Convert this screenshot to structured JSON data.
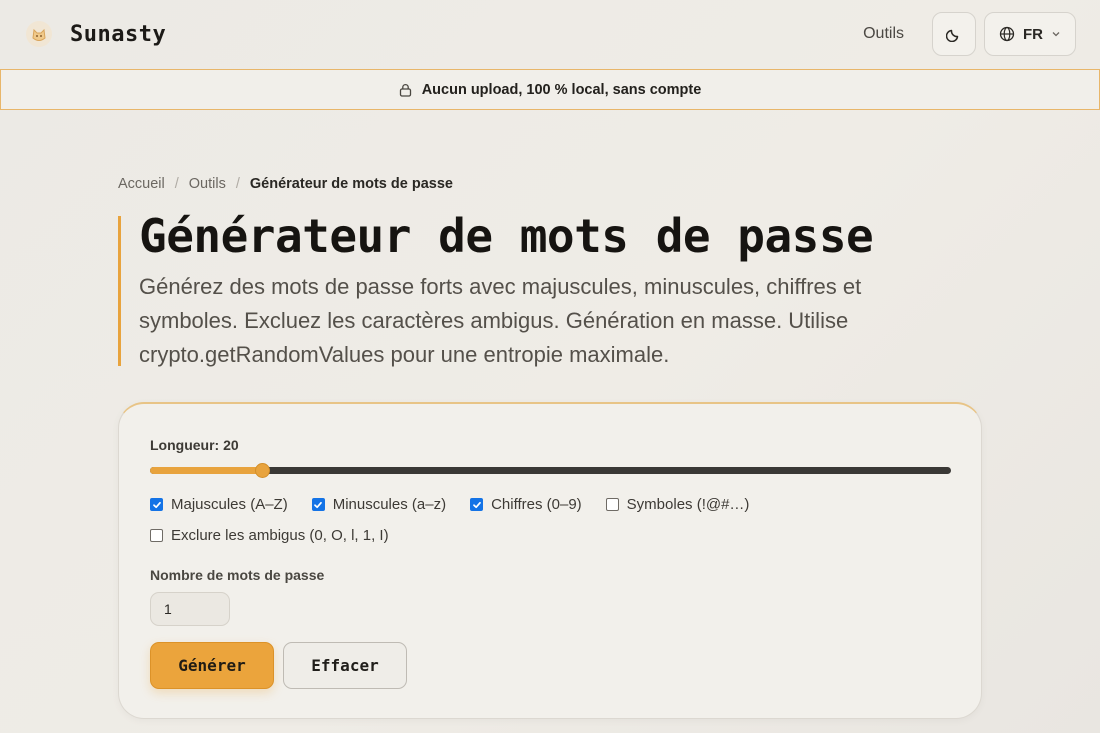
{
  "brand": {
    "name": "Sunasty",
    "logo": "cat-logo-icon"
  },
  "nav": {
    "tools_label": "Outils",
    "theme_icon": "moon-icon",
    "language": "FR",
    "language_icon": "globe-icon"
  },
  "banner": {
    "icon": "lock-icon",
    "text": "Aucun upload, 100 % local, sans compte"
  },
  "breadcrumb": {
    "home": "Accueil",
    "tools": "Outils",
    "current": "Générateur de mots de passe",
    "separator": "/"
  },
  "page": {
    "title": "Générateur de mots de passe",
    "description": "Générez des mots de passe forts avec majuscules, minuscules, chiffres et symboles. Excluez les caractères ambigus. Génération en masse. Utilise crypto.getRandomValues pour une entropie maximale."
  },
  "generator": {
    "length_label": "Longueur: 20",
    "slider_fraction": 0.14,
    "options": [
      {
        "label": "Majuscules (A–Z)",
        "checked": true
      },
      {
        "label": "Minuscules (a–z)",
        "checked": true
      },
      {
        "label": "Chiffres (0–9)",
        "checked": true
      },
      {
        "label": "Symboles (!@#…)",
        "checked": false
      }
    ],
    "exclude_ambiguous": {
      "label": "Exclure les ambigus (0, O, l, 1, I)",
      "checked": false
    },
    "count_label": "Nombre de mots de passe",
    "count_value": "1",
    "generate_label": "Générer",
    "clear_label": "Effacer"
  },
  "colors": {
    "accent": "#e8a33d",
    "checkbox": "#1473e6",
    "track": "#3a3835"
  }
}
